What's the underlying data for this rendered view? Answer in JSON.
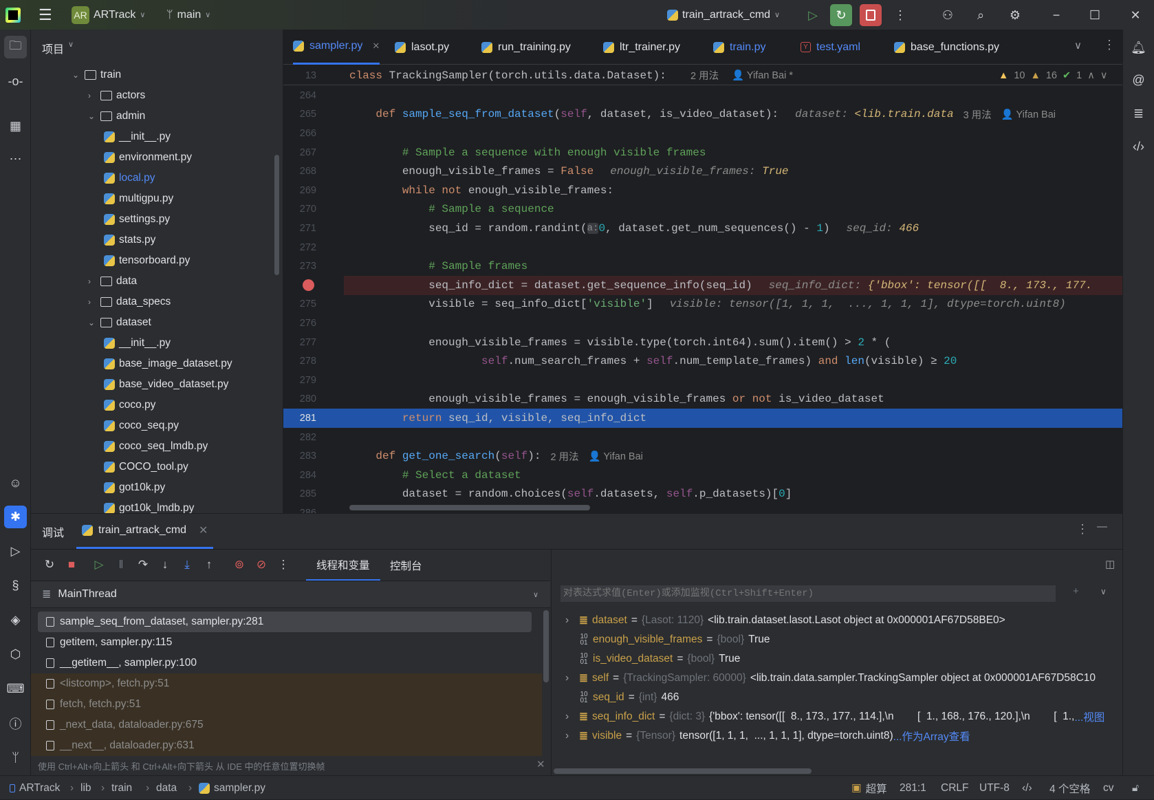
{
  "titlebar": {
    "project_badge": "AR",
    "project": "ARTrack",
    "branch": "main",
    "run_config": "train_artrack_cmd"
  },
  "project_panel": {
    "title": "项目",
    "items": [
      {
        "label": "train",
        "type": "folder",
        "depth": 0,
        "expanded": true
      },
      {
        "label": "actors",
        "type": "folder",
        "depth": 1,
        "expanded": false
      },
      {
        "label": "admin",
        "type": "folder",
        "depth": 1,
        "expanded": true
      },
      {
        "label": "__init__.py",
        "type": "py",
        "depth": 2
      },
      {
        "label": "environment.py",
        "type": "py",
        "depth": 2
      },
      {
        "label": "local.py",
        "type": "py",
        "depth": 2,
        "modified": true
      },
      {
        "label": "multigpu.py",
        "type": "py",
        "depth": 2
      },
      {
        "label": "settings.py",
        "type": "py",
        "depth": 2
      },
      {
        "label": "stats.py",
        "type": "py",
        "depth": 2
      },
      {
        "label": "tensorboard.py",
        "type": "py",
        "depth": 2
      },
      {
        "label": "data",
        "type": "folder",
        "depth": 1,
        "expanded": false
      },
      {
        "label": "data_specs",
        "type": "folder",
        "depth": 1,
        "expanded": false,
        "plain": true
      },
      {
        "label": "dataset",
        "type": "folder",
        "depth": 1,
        "expanded": true
      },
      {
        "label": "__init__.py",
        "type": "py",
        "depth": 2
      },
      {
        "label": "base_image_dataset.py",
        "type": "py",
        "depth": 2
      },
      {
        "label": "base_video_dataset.py",
        "type": "py",
        "depth": 2
      },
      {
        "label": "coco.py",
        "type": "py",
        "depth": 2
      },
      {
        "label": "coco_seq.py",
        "type": "py",
        "depth": 2
      },
      {
        "label": "coco_seq_lmdb.py",
        "type": "py",
        "depth": 2
      },
      {
        "label": "COCO_tool.py",
        "type": "py",
        "depth": 2
      },
      {
        "label": "got10k.py",
        "type": "py",
        "depth": 2
      },
      {
        "label": "got10k_lmdb.py",
        "type": "py",
        "depth": 2
      }
    ]
  },
  "tabs": [
    {
      "label": "sampler.py",
      "icon": "python",
      "active": true,
      "color": "#548af7"
    },
    {
      "label": "lasot.py",
      "icon": "python"
    },
    {
      "label": "run_training.py",
      "icon": "python"
    },
    {
      "label": "ltr_trainer.py",
      "icon": "python"
    },
    {
      "label": "train.py",
      "icon": "python",
      "color": "#548af7"
    },
    {
      "label": "test.yaml",
      "icon": "yaml",
      "color": "#548af7"
    },
    {
      "label": "base_functions.py",
      "icon": "python"
    }
  ],
  "editor": {
    "sticky": {
      "line": "13",
      "tokens": [
        [
          "kw",
          "class "
        ],
        [
          "pl",
          "TrackingSampler(torch.utils.data.Dataset):"
        ]
      ],
      "usages": "2 用法",
      "author": "Yifan Bai *"
    },
    "inspections": {
      "warnings": "10",
      "weak_warnings": "16",
      "ok": "1"
    },
    "lines": [
      {
        "n": "264",
        "tokens": []
      },
      {
        "n": "265",
        "tokens": [
          [
            "kw",
            "    def "
          ],
          [
            "fn",
            "sample_seq_from_dataset"
          ],
          [
            "pl",
            "("
          ],
          [
            "sf",
            "self"
          ],
          [
            "pl",
            ", dataset, is_video_dataset):"
          ]
        ],
        "usages": "3 用法",
        "author": "Yifan Bai",
        "inline": [
          [
            "hint",
            "dataset: "
          ],
          [
            "hv",
            "<lib.train.data"
          ]
        ]
      },
      {
        "n": "266",
        "tokens": []
      },
      {
        "n": "267",
        "tokens": [
          [
            "cm",
            "        # Sample a sequence with enough visible frames"
          ]
        ]
      },
      {
        "n": "268",
        "tokens": [
          [
            "pl",
            "        enough_visible_frames = "
          ],
          [
            "kw",
            "False"
          ]
        ],
        "inline": [
          [
            "hint",
            "enough_visible_frames: "
          ],
          [
            "hv",
            "True"
          ]
        ]
      },
      {
        "n": "269",
        "tokens": [
          [
            "kw",
            "        while not "
          ],
          [
            "pl",
            "enough_visible_frames:"
          ]
        ]
      },
      {
        "n": "270",
        "tokens": [
          [
            "cm",
            "            # Sample a sequence"
          ]
        ]
      },
      {
        "n": "271",
        "tokens": [
          [
            "pl",
            "            seq_id = random.randint("
          ],
          [
            "pm",
            "a:"
          ],
          [
            "nu",
            "0"
          ],
          [
            "pl",
            ", dataset.get_num_sequences() - "
          ],
          [
            "nu",
            "1"
          ],
          [
            "pl",
            ")"
          ]
        ],
        "inline": [
          [
            "hint",
            "seq_id: "
          ],
          [
            "hv",
            "466"
          ]
        ]
      },
      {
        "n": "272",
        "tokens": []
      },
      {
        "n": "273",
        "tokens": [
          [
            "cm",
            "            # Sample frames"
          ]
        ]
      },
      {
        "n": "",
        "breakpoint": true,
        "tokens": [
          [
            "pl",
            "            seq_info_dict = dataset.get_sequence_info(seq_id)"
          ]
        ],
        "inline": [
          [
            "hint",
            "seq_info_dict: "
          ],
          [
            "hv",
            "{'bbox': tensor([[  8., 173., 177."
          ]
        ]
      },
      {
        "n": "275",
        "tokens": [
          [
            "pl",
            "            visible = seq_info_dict["
          ],
          [
            "st",
            "'visible'"
          ],
          [
            "pl",
            "]"
          ]
        ],
        "inline": [
          [
            "hint",
            "visible: tensor([1, 1, 1,  ..., 1, 1, 1], dtype=torch.uint8)"
          ]
        ]
      },
      {
        "n": "276",
        "tokens": []
      },
      {
        "n": "277",
        "tokens": [
          [
            "pl",
            "            enough_visible_frames = visible.type(torch.int64).sum().item() > "
          ],
          [
            "nu",
            "2"
          ],
          [
            "pl",
            " * ("
          ]
        ]
      },
      {
        "n": "278",
        "tokens": [
          [
            "sf",
            "                    self"
          ],
          [
            "pl",
            ".num_search_frames + "
          ],
          [
            "sf",
            "self"
          ],
          [
            "pl",
            ".num_template_frames) "
          ],
          [
            "kw",
            "and "
          ],
          [
            "fn",
            "len"
          ],
          [
            "pl",
            "(visible) ≥ "
          ],
          [
            "nu",
            "20"
          ]
        ]
      },
      {
        "n": "279",
        "tokens": []
      },
      {
        "n": "280",
        "tokens": [
          [
            "pl",
            "            enough_visible_frames = enough_visible_frames "
          ],
          [
            "kw",
            "or not "
          ],
          [
            "pl",
            "is_video_dataset"
          ]
        ]
      },
      {
        "n": "281",
        "current": true,
        "tokens": [
          [
            "kw",
            "        return "
          ],
          [
            "pl",
            "seq_id, visible, seq_info_dict"
          ]
        ]
      },
      {
        "n": "282",
        "tokens": []
      },
      {
        "n": "283",
        "tokens": [
          [
            "kw",
            "    def "
          ],
          [
            "fn",
            "get_one_search"
          ],
          [
            "pl",
            "("
          ],
          [
            "sf",
            "self"
          ],
          [
            "pl",
            "):"
          ]
        ],
        "usages": "2 用法",
        "author": "Yifan Bai"
      },
      {
        "n": "284",
        "tokens": [
          [
            "cm",
            "        # Select a dataset"
          ]
        ]
      },
      {
        "n": "285",
        "tokens": [
          [
            "pl",
            "        dataset = random.choices("
          ],
          [
            "sf",
            "self"
          ],
          [
            "pl",
            ".datasets, "
          ],
          [
            "sf",
            "self"
          ],
          [
            "pl",
            ".p_datasets)["
          ],
          [
            "nu",
            "0"
          ],
          [
            "pl",
            "]"
          ]
        ]
      },
      {
        "n": "286",
        "tokens": []
      }
    ]
  },
  "debug": {
    "title": "调试",
    "session": "train_artrack_cmd",
    "tab_threads": "线程和变量",
    "tab_console": "控制台",
    "thread": "MainThread",
    "frames": [
      {
        "label": "sample_seq_from_dataset, sampler.py:281",
        "selected": true
      },
      {
        "label": "getitem, sampler.py:115"
      },
      {
        "label": "__getitem__, sampler.py:100"
      },
      {
        "label": "<listcomp>, fetch.py:51",
        "library": true
      },
      {
        "label": "fetch, fetch.py:51",
        "library": true
      },
      {
        "label": "_next_data, dataloader.py:675",
        "library": true
      },
      {
        "label": "__next__, dataloader.py:631",
        "library": true
      }
    ],
    "hint": "使用 Ctrl+Alt+向上箭头 和 Ctrl+Alt+向下箭头 从 IDE 中的任意位置切换帧",
    "eval_placeholder": "对表达式求值(Enter)或添加监视(Ctrl+Shift+Enter)",
    "variables": [
      {
        "name": "dataset",
        "type": "{Lasot: 1120}",
        "value": "<lib.train.dataset.lasot.Lasot object at 0x000001AF67D58BE0>",
        "expandable": true,
        "icon": "object"
      },
      {
        "name": "enough_visible_frames",
        "type": "{bool}",
        "value": "True",
        "icon": "primitive"
      },
      {
        "name": "is_video_dataset",
        "type": "{bool}",
        "value": "True",
        "icon": "primitive"
      },
      {
        "name": "self",
        "type": "{TrackingSampler: 60000}",
        "value": "<lib.train.data.sampler.TrackingSampler object at 0x000001AF67D58C10",
        "expandable": true,
        "icon": "object"
      },
      {
        "name": "seq_id",
        "type": "{int}",
        "value": "466",
        "icon": "primitive"
      },
      {
        "name": "seq_info_dict",
        "type": "{dict: 3}",
        "value": "{'bbox': tensor([[  8., 173., 177., 114.],\\n        [  1., 168., 176., 120.],\\n        [  1.,",
        "link": "...视图",
        "expandable": true,
        "icon": "object"
      },
      {
        "name": "visible",
        "type": "{Tensor}",
        "value": "tensor([1, 1, 1,  ..., 1, 1, 1], dtype=torch.uint8)",
        "link": "...作为Array查看",
        "expandable": true,
        "icon": "object"
      }
    ]
  },
  "statusbar": {
    "breadcrumb": [
      "ARTrack",
      "lib",
      "train",
      "data",
      "sampler.py"
    ],
    "sftp": "超算",
    "position": "281:1",
    "line_sep": "CRLF",
    "encoding": "UTF-8",
    "indent": "4 个空格",
    "interpreter": "cv"
  },
  "colors": {
    "accent": "#3574f0",
    "breakpoint": "#db5c5c",
    "current_line": "#2154a8",
    "breakpoint_line": "#3b2325",
    "run_green": "#57965c",
    "stop_red": "#c94f4f"
  }
}
